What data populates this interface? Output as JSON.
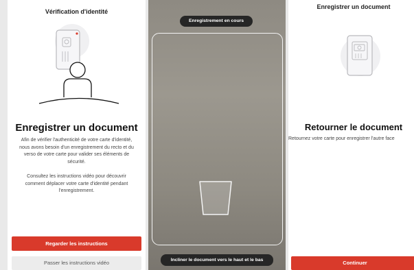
{
  "screen1": {
    "title": "Vérification d'identité",
    "heading": "Enregistrer un document",
    "body": "Afin de vérifier l'authenticité de votre carte d'identité,\nnous avons besoin d'un enregistrement du recto et du\nverso de votre carte pour valider ses éléments de\nsécurité.",
    "body2": "Consultez les instructions vidéo pour découvrir\ncomment déplacer votre carte d'identité pendant\nl'enregistrement.",
    "primary_button": "Regarder les instructions",
    "secondary_button": "Passer les instructions vidéo"
  },
  "screen2": {
    "status": "Enregistrement en cours",
    "instruction": "Incliner le document vers le haut et le bas"
  },
  "screen3": {
    "title": "Enregistrer un document",
    "heading": "Retourner le document",
    "body": "Retournez votre carte pour enregistrer l'autre face",
    "primary_button": "Continuer"
  },
  "colors": {
    "accent": "#d93a2b",
    "pill": "#262626"
  }
}
